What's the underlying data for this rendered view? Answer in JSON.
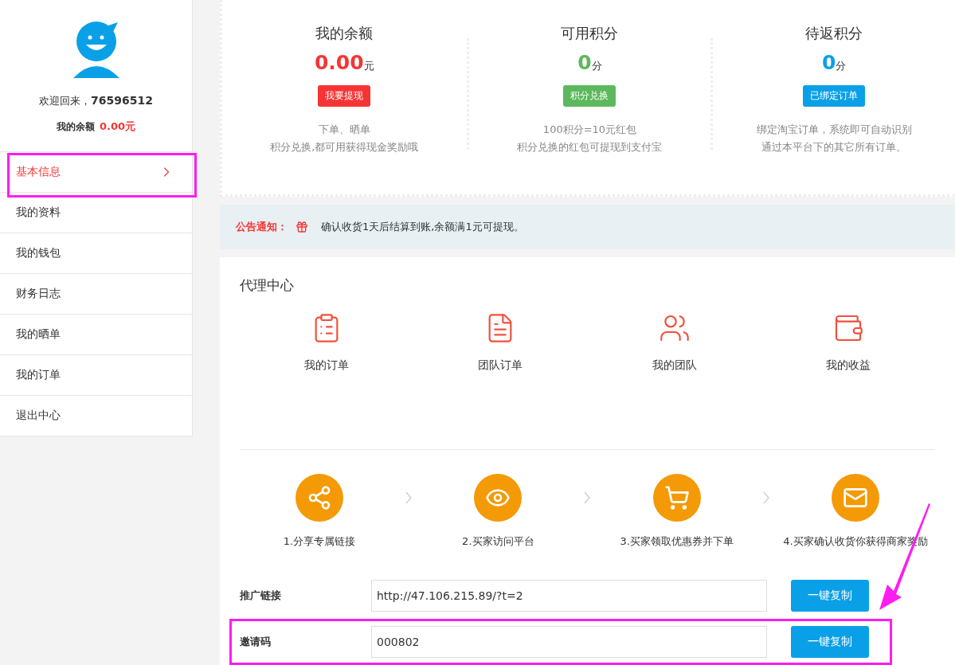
{
  "sidebar": {
    "welcome": "欢迎回来，",
    "username": "76596512",
    "balance_label": "我的余额",
    "balance_value": "0.00元",
    "items": [
      {
        "label": "基本信息",
        "selected": true
      },
      {
        "label": "我的资料",
        "selected": false
      },
      {
        "label": "我的钱包",
        "selected": false
      },
      {
        "label": "财务日志",
        "selected": false
      },
      {
        "label": "我的晒单",
        "selected": false
      },
      {
        "label": "我的订单",
        "selected": false
      },
      {
        "label": "退出中心",
        "selected": false
      }
    ]
  },
  "stats": [
    {
      "title": "我的余额",
      "value": "0.00",
      "unit": "元",
      "button": "我要提现",
      "color": "#f63434",
      "lines": [
        "下单、晒单",
        "积分兑换,都可用获得现金奖励哦"
      ]
    },
    {
      "title": "可用积分",
      "value": "0",
      "unit": "分",
      "button": "积分兑换",
      "color": "#5cb85c",
      "lines": [
        "100积分=10元红包",
        "积分兑换的红包可提现到支付宝"
      ]
    },
    {
      "title": "待返积分",
      "value": "0",
      "unit": "分",
      "button": "已绑定订单",
      "color": "#0aa0e8",
      "lines": [
        "绑定淘宝订单，系统即可自动识别",
        "通过本平台下的其它所有订单。"
      ]
    }
  ],
  "notice": {
    "label": "公告通知：",
    "text": "确认收货1天后结算到账,余额满1元可提现。"
  },
  "agent": {
    "title": "代理中心",
    "shortcuts": [
      {
        "kind": "orders",
        "label": "我的订单"
      },
      {
        "kind": "team_orders",
        "label": "团队订单"
      },
      {
        "kind": "team",
        "label": "我的团队"
      },
      {
        "kind": "earnings",
        "label": "我的收益"
      }
    ],
    "steps": [
      {
        "kind": "share",
        "label": "1.分享专属链接"
      },
      {
        "kind": "visit",
        "label": "2.买家访问平台"
      },
      {
        "kind": "cart",
        "label": "3.买家领取优惠券并下单"
      },
      {
        "kind": "reward",
        "label": "4.买家确认收货你获得商家奖励"
      }
    ],
    "fields": [
      {
        "label": "推广链接",
        "value": "http://47.106.215.89/?t=2",
        "button": "一键复制",
        "highlighted": false
      },
      {
        "label": "邀请码",
        "value": "000802",
        "button": "一键复制",
        "highlighted": true
      }
    ]
  }
}
